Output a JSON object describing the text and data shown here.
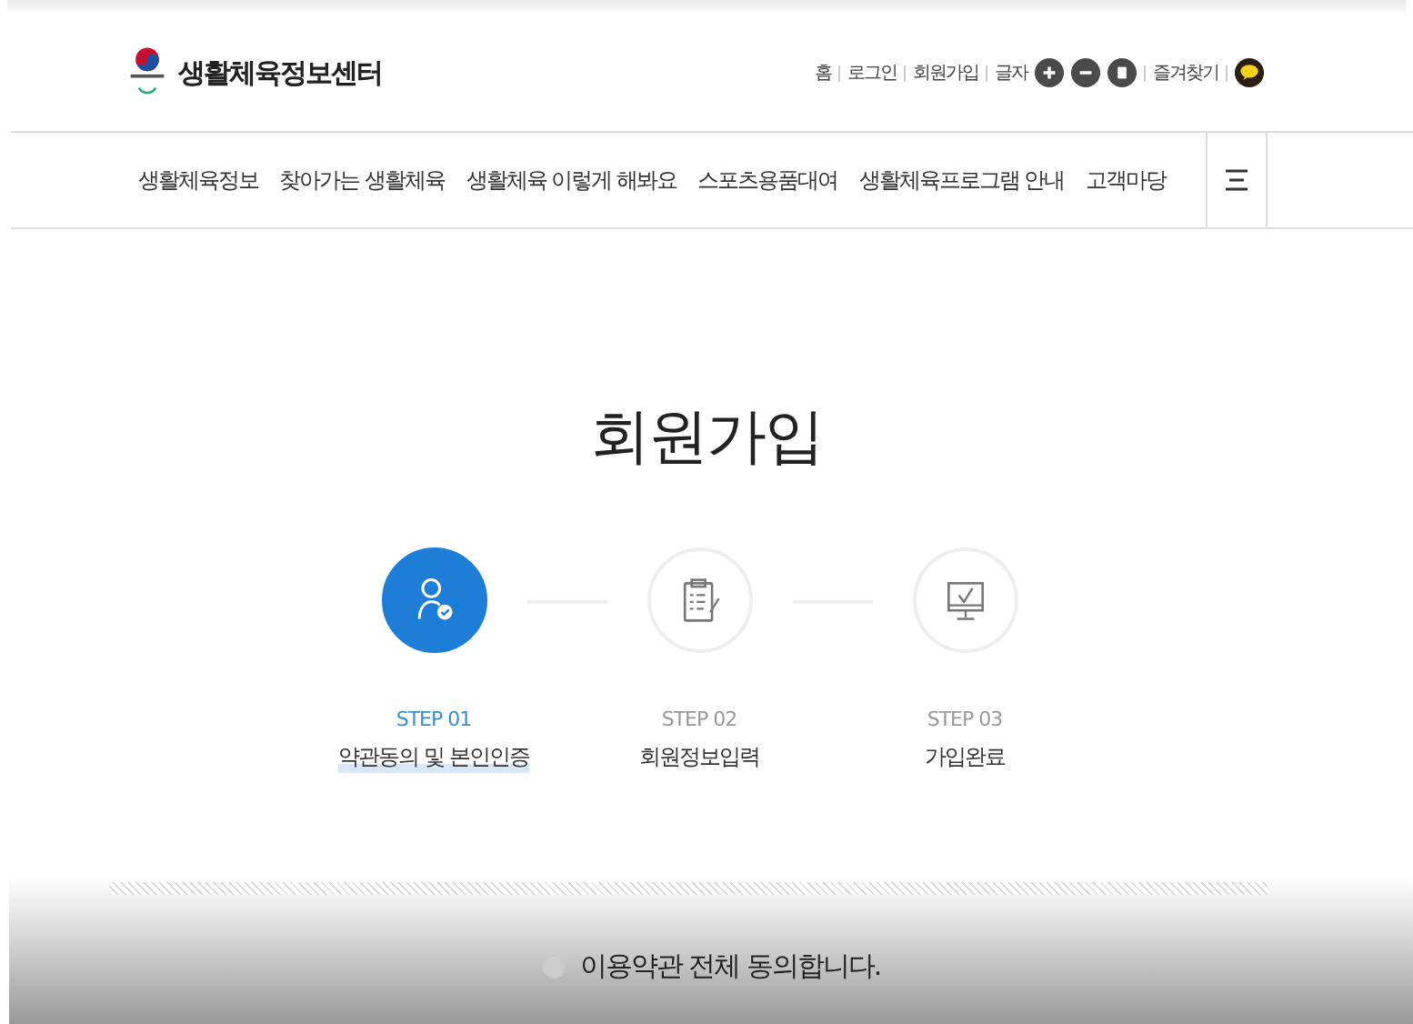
{
  "header": {
    "site_name": "생활체육정보센터",
    "utility_links": [
      "홈",
      "로그인",
      "회원가입"
    ],
    "font_size_label": "글자",
    "font_buttons": [
      {
        "kind": "plus"
      },
      {
        "kind": "minus"
      },
      {
        "kind": "reset"
      }
    ],
    "favorites": "즐겨찾기"
  },
  "nav": {
    "items": [
      "생활체육정보",
      "찾아가는 생활체육",
      "생활체육 이렇게 해봐요",
      "스포츠용품대여",
      "생활체육프로그램 안내",
      "고객마당"
    ]
  },
  "page_title": "회원가입",
  "steps": [
    {
      "kind": "user",
      "step": "STEP 01",
      "label": "약관동의 및 본인인증",
      "selected": true
    },
    {
      "kind": "clipboard",
      "step": "STEP 02",
      "label": "회원정보입력",
      "selected": false
    },
    {
      "kind": "monitor",
      "step": "STEP 03",
      "label": "가입완료",
      "selected": false
    }
  ],
  "agree_all": {
    "label": "이용약관 전체 동의합니다.",
    "checked": false
  }
}
